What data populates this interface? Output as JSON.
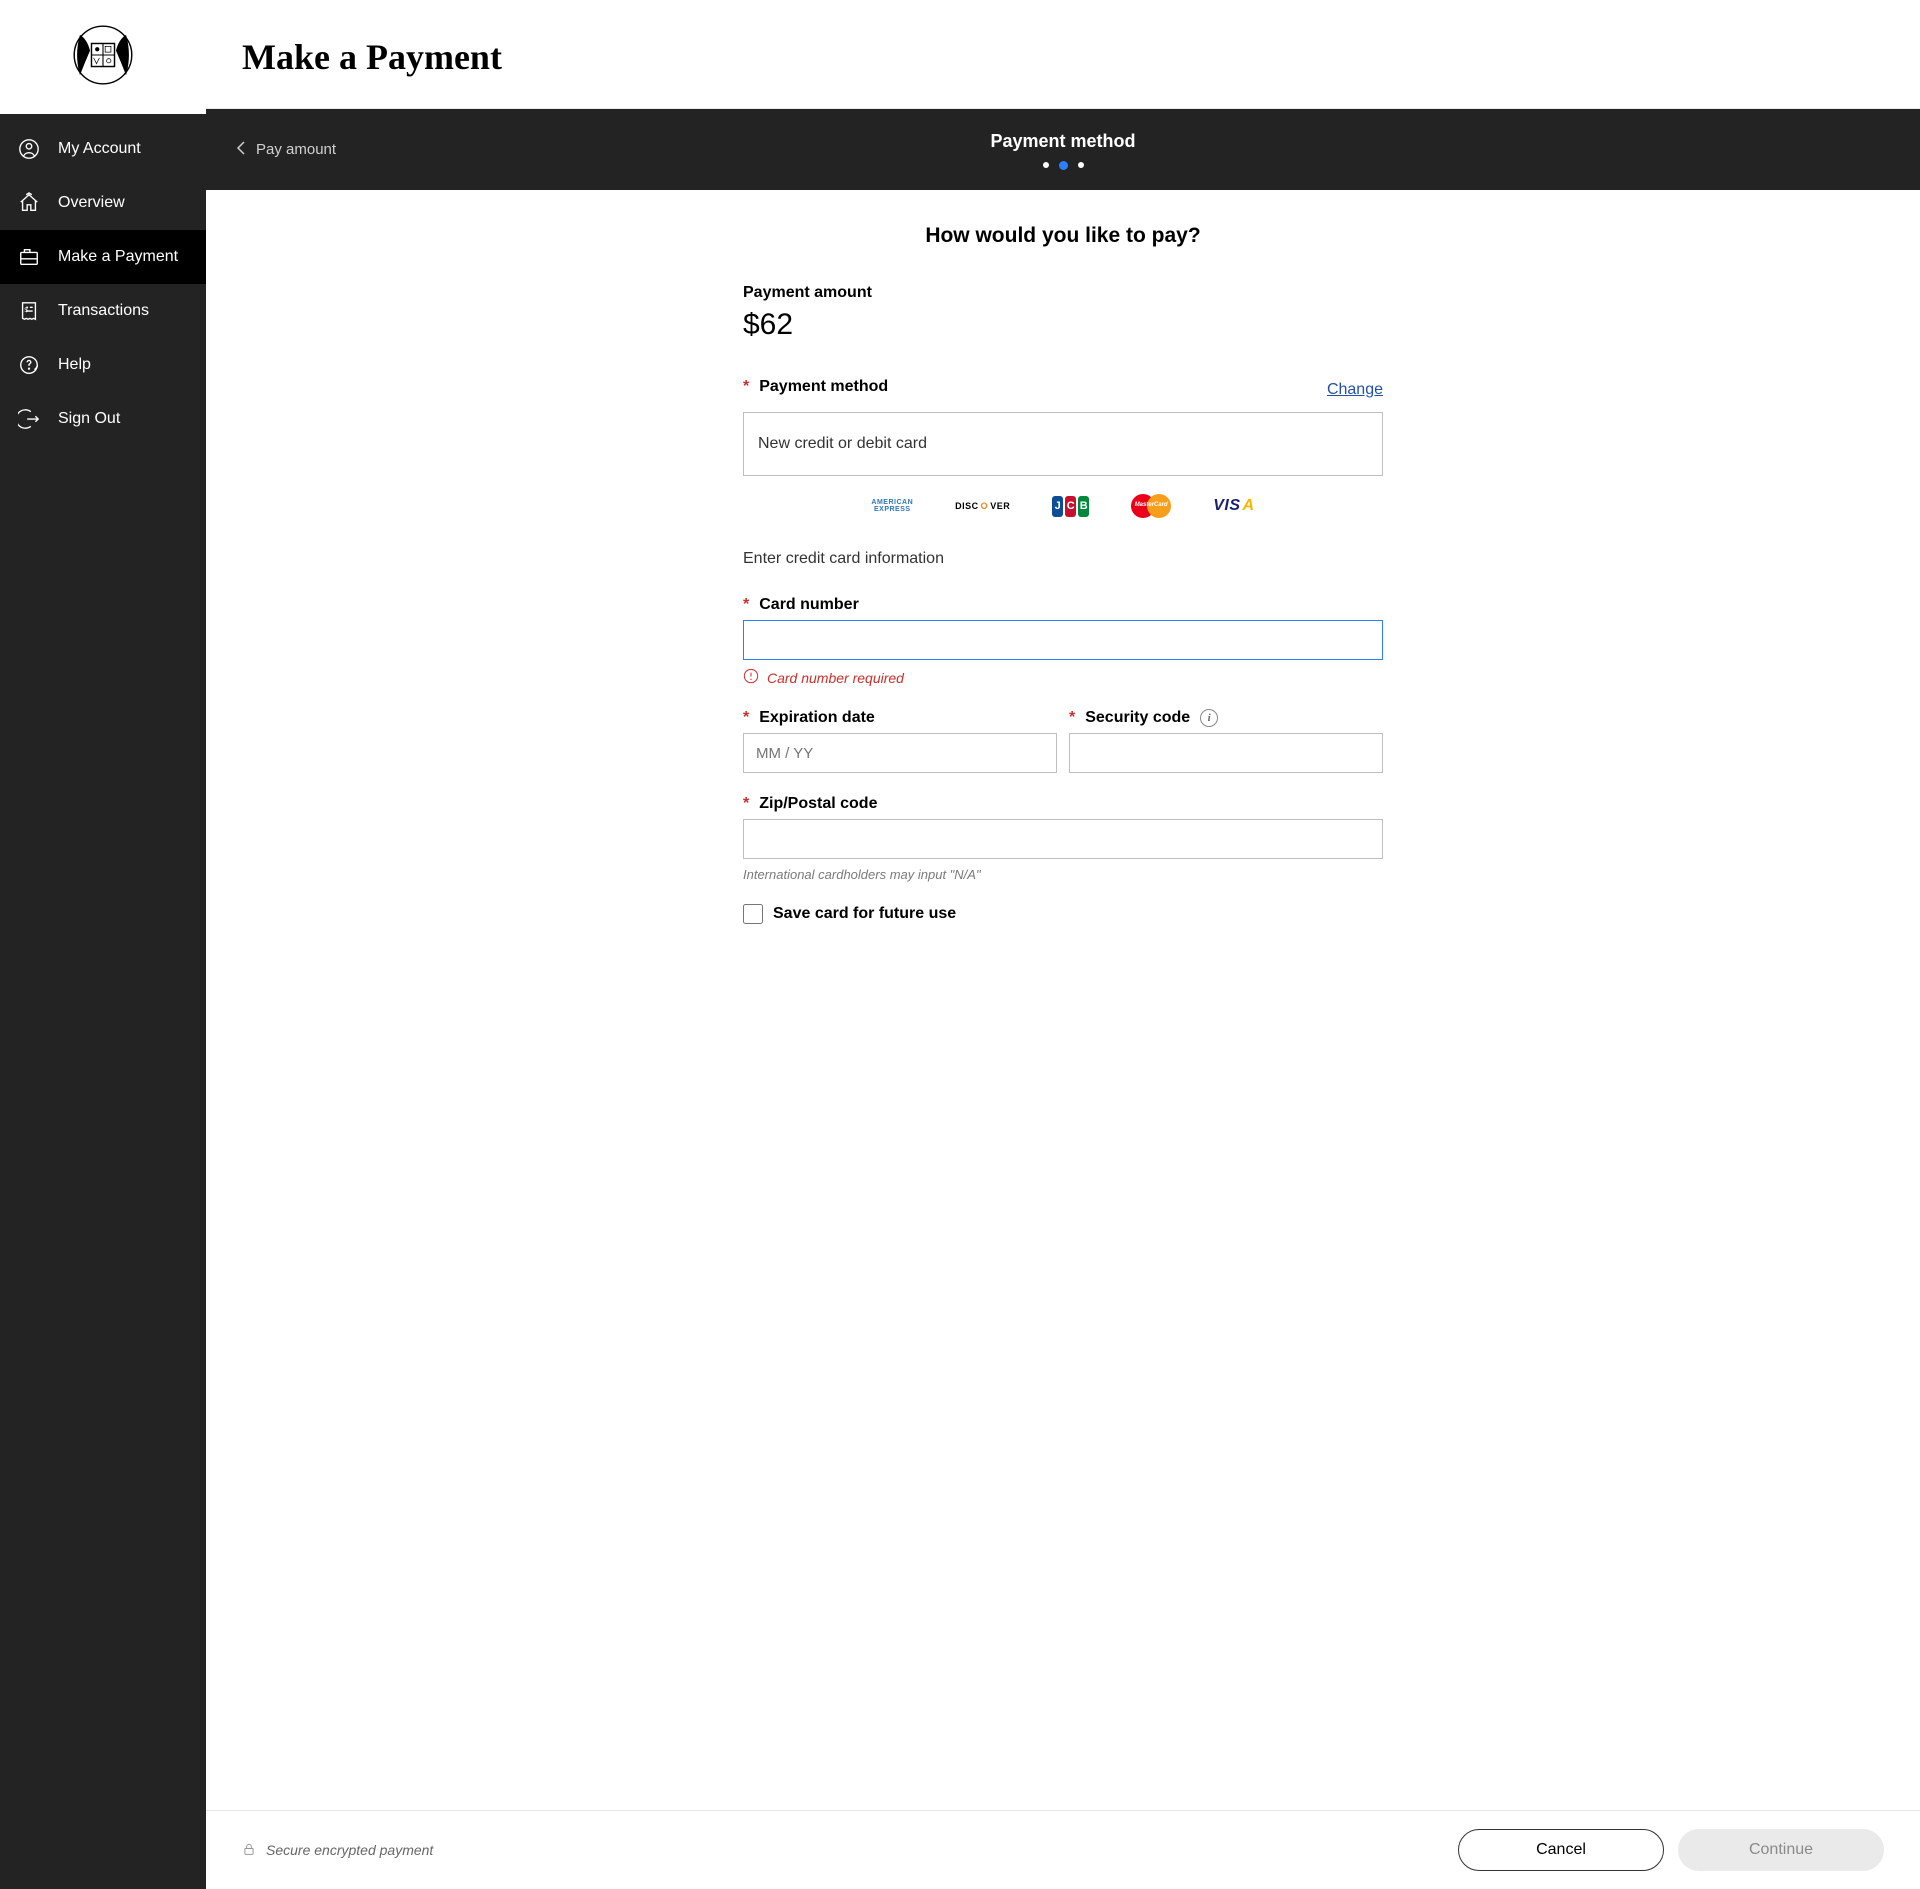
{
  "header": {
    "title": "Make a Payment"
  },
  "nav": {
    "items": [
      {
        "label": "My Account",
        "icon": "user-circle-icon",
        "active": false
      },
      {
        "label": "Overview",
        "icon": "home-icon",
        "active": false
      },
      {
        "label": "Make a Payment",
        "icon": "register-icon",
        "active": true
      },
      {
        "label": "Transactions",
        "icon": "receipt-icon",
        "active": false
      },
      {
        "label": "Help",
        "icon": "question-circle-icon",
        "active": false
      },
      {
        "label": "Sign Out",
        "icon": "sign-out-icon",
        "active": false
      }
    ]
  },
  "steps": {
    "back_label": "Pay amount",
    "current_title": "Payment method",
    "dots": [
      false,
      true,
      false
    ]
  },
  "form": {
    "question": "How would you like to pay?",
    "amount_label": "Payment amount",
    "amount_value": "$62",
    "method_label": "Payment method",
    "change_label": "Change",
    "method_value": "New credit or debit card",
    "card_brands": [
      "AMERICAN EXPRESS",
      "DISCOVER",
      "JCB",
      "MasterCard",
      "VISA"
    ],
    "cc_section_hint": "Enter credit card information",
    "card_number": {
      "label": "Card number",
      "value": "",
      "error": "Card number required"
    },
    "expiration": {
      "label": "Expiration date",
      "placeholder": "MM / YY",
      "value": ""
    },
    "security": {
      "label": "Security code",
      "value": ""
    },
    "zip": {
      "label": "Zip/Postal code",
      "value": "",
      "hint": "International cardholders may input \"N/A\""
    },
    "save_card_label": "Save card for future use",
    "save_card_checked": false
  },
  "footer": {
    "secure_text": "Secure encrypted payment",
    "cancel_label": "Cancel",
    "continue_label": "Continue"
  }
}
